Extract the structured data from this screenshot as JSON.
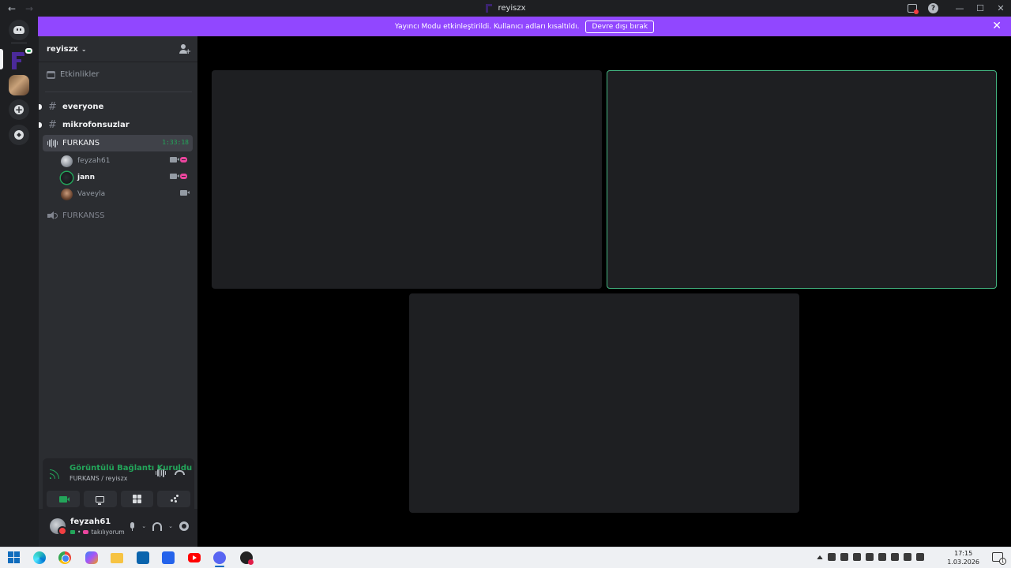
{
  "window": {
    "title": "reyiszx",
    "back_icon": "←",
    "forward_icon": "→",
    "help_icon": "?",
    "minimize_icon": "—",
    "maximize_icon": "☐",
    "close_icon": "✕"
  },
  "banner": {
    "message": "Yayıncı Modu etkinleştirildi. Kullanıcı adları kısaltıldı.",
    "button_label": "Devre dışı bırak",
    "close_icon": "✕"
  },
  "server": {
    "name": "reyiszx",
    "chevron": "⌄"
  },
  "events_label": "Etkinlikler",
  "channels": [
    {
      "name": "everyone",
      "type": "text",
      "unread": true
    },
    {
      "name": "mikrofonsuzlar",
      "type": "text",
      "unread": true
    }
  ],
  "voice_channel": {
    "name": "FURKANS",
    "timer": "1:33:18",
    "members": [
      {
        "name": "feyzah61",
        "camera": true,
        "controller": true
      },
      {
        "name": "jann",
        "camera": true,
        "controller": true
      },
      {
        "name": "Vaveyla",
        "camera": true,
        "controller": false
      }
    ]
  },
  "voice_channel_2": {
    "name": "FURKANSS"
  },
  "voice_connection": {
    "status": "Görüntülü Bağlantı Kuruldu",
    "location": "FURKANS / reyiszx"
  },
  "user_panel": {
    "username": "feyzah61",
    "status_text": "takılıyorum",
    "separator": "•"
  },
  "taskbar": {
    "time": "17:15",
    "date": "1.03.2026",
    "notification_count": "1"
  },
  "colors": {
    "accent_purple": "#9147ff",
    "speaking_green": "#23a55a",
    "tile_border_active": "#43b581"
  }
}
